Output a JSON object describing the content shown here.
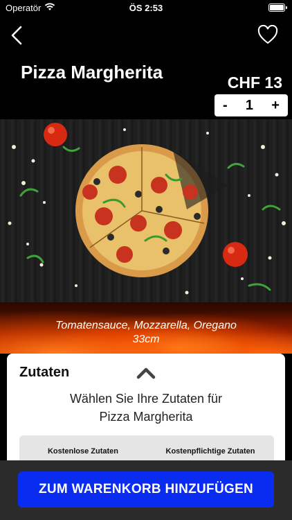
{
  "status_bar": {
    "carrier": "Operatör",
    "time": "ÖS 2:53"
  },
  "nav": {
    "back_icon": "chevron-left-icon",
    "favorite_icon": "heart-outline-icon"
  },
  "product": {
    "name": "Pizza Margherita",
    "price": "CHF 13",
    "quantity": "1",
    "decrement_label": "-",
    "increment_label": "+",
    "description": "Tomatensauce, Mozzarella, Oregano",
    "size": "33cm"
  },
  "ingredients": {
    "heading": "Zutaten",
    "prompt_line1": "Wählen Sie Ihre Zutaten für",
    "prompt_line2": "Pizza Margherita",
    "tab_free": "Kostenlose Zutaten",
    "tab_paid": "Kostenpflichtige Zutaten"
  },
  "cta": {
    "label": "ZUM WARENKORB HINZUFÜGEN",
    "color": "#0a2cf0"
  }
}
